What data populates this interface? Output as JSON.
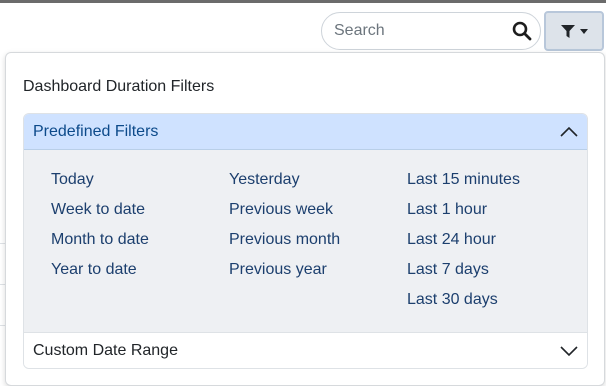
{
  "search": {
    "placeholder": "Search",
    "icon": "search-icon"
  },
  "filter_button": {
    "icon": "filter-icon"
  },
  "panel": {
    "title": "Dashboard Duration Filters",
    "predefined": {
      "label": "Predefined Filters",
      "expanded": true,
      "columns": [
        [
          "Today",
          "Week to date",
          "Month to date",
          "Year to date"
        ],
        [
          "Yesterday",
          "Previous week",
          "Previous month",
          "Previous year"
        ],
        [
          "Last 15 minutes",
          "Last 1 hour",
          "Last 24 hour",
          "Last 7 days",
          "Last 30 days"
        ]
      ]
    },
    "custom": {
      "label": "Custom Date Range",
      "expanded": false
    }
  },
  "colors": {
    "header_bg": "#cfe2ff",
    "link": "#1c3f6e",
    "body_bg": "#eef0f3"
  }
}
